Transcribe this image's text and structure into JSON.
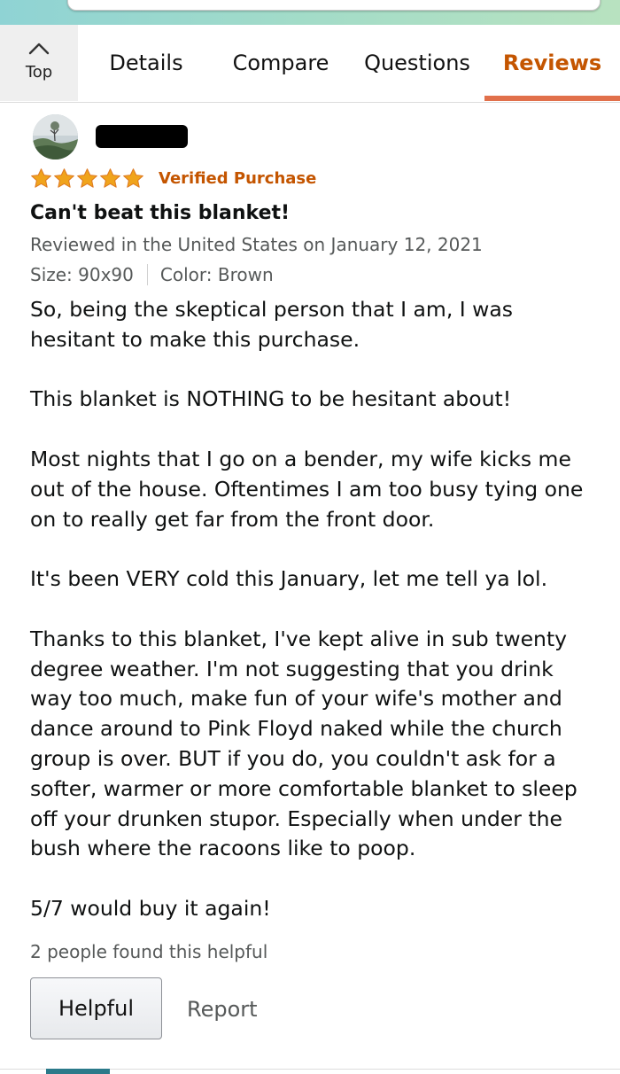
{
  "tabs": {
    "top_label": "Top",
    "items": [
      "Details",
      "Compare",
      "Questions",
      "Reviews"
    ],
    "active": "Reviews"
  },
  "review": {
    "rating": 5,
    "rating_max": 5,
    "verified": "Verified Purchase",
    "title": "Can't beat this blanket!",
    "reviewed_in": "Reviewed in the United States on January 12, 2021",
    "size": "Size: 90x90",
    "color": "Color: Brown",
    "paragraphs": [
      "So, being the skeptical person that I am, I was hesitant to make this purchase.",
      "This blanket is NOTHING to be hesitant about!",
      "Most nights that I go on a bender, my wife kicks me out of the house. Oftentimes I am too busy tying one on to really get far from the front door.",
      "It's been VERY cold this January, let me tell ya lol.",
      "Thanks to this blanket, I've kept alive in sub twenty degree weather. I'm not suggesting that you drink way too much, make fun of your wife's mother and dance around to Pink Floyd naked while the church group is over. BUT if you do, you couldn't ask for a softer, warmer or more comfortable blanket to sleep off your drunken stupor. Especially when under the bush where the racoons like to poop.",
      "5/7 would buy it again!"
    ],
    "helpful_count": "2 people found this helpful",
    "helpful_label": "Helpful",
    "report_label": "Report"
  },
  "colors": {
    "accent": "#c45500",
    "tab_underline": "#e1704b",
    "star": "#f0a41c",
    "muted_text": "#565959"
  },
  "icons": {
    "top": "chevron-up-icon",
    "star": "star-icon"
  }
}
